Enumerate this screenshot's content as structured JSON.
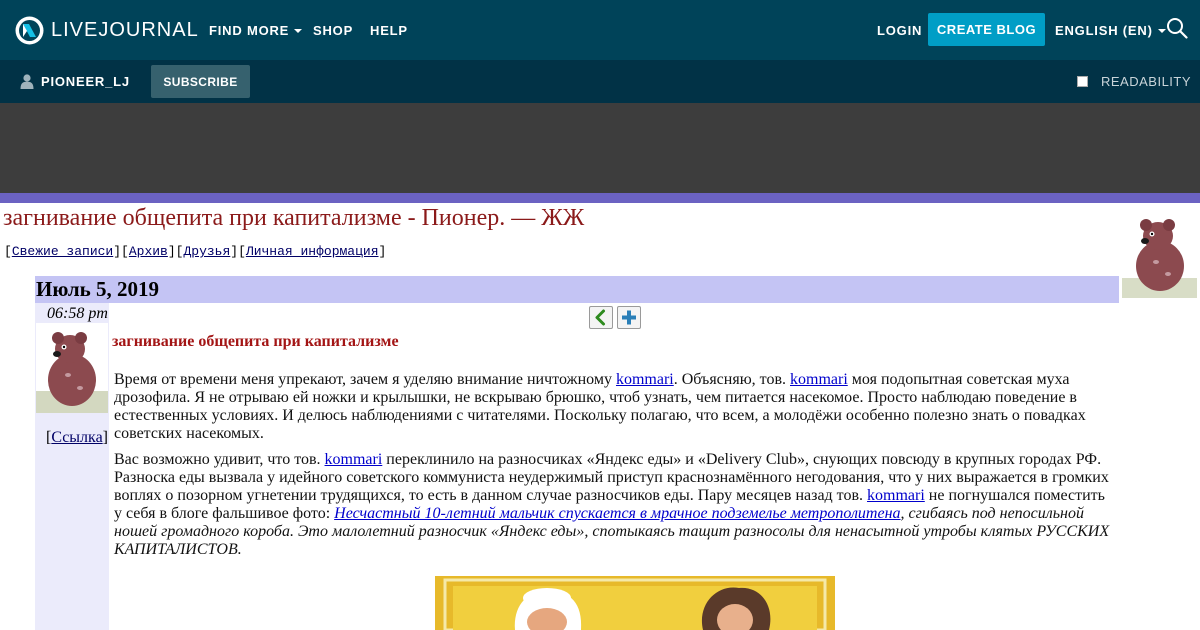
{
  "header": {
    "logo_text": "LIVEJOURNAL",
    "nav": {
      "find_more": "FIND MORE",
      "shop": "SHOP",
      "help": "HELP"
    },
    "login": "LOGIN",
    "create_blog": "CREATE BLOG",
    "language": "ENGLISH (EN)"
  },
  "subbar": {
    "username": "PIONEER_LJ",
    "subscribe": "SUBSCRIBE",
    "readability": "READABILITY"
  },
  "journal": {
    "page_title": "загнивание общепита при капитализме - Пионер. — ЖЖ",
    "nav_links": [
      "Свежие записи",
      "Архив",
      "Друзья",
      "Личная информация"
    ],
    "date": "Июль 5, 2019",
    "time": "06:58 pm",
    "link_label": "Ссылка"
  },
  "post": {
    "subject": "загнивание общепита при капитализме",
    "p1": {
      "t1": "Время от времени меня упрекают, зачем я уделяю внимание ничтожному ",
      "l1": "kommari",
      "t2": ". Объясняю, тов. ",
      "l2": "kommari",
      "t3": " моя подопытная советская муха дрозофила. Я не отрываю ей ножки и крылышки, не вскрываю брюшко, чтоб узнать, чем питается насекомое. Просто наблюдаю поведение в естественных условиях. И делюсь наблюдениями с читателями. Поскольку полагаю, что всем, а молодёжи особенно полезно знать о повадках советских насекомых."
    },
    "p2": {
      "t1": "Вас возможно удивит, что тов. ",
      "l1": "kommari",
      "t2": " переклинило на разносчиках «Яндекс еды» и «Delivery Club», снующих повсюду в крупных городах РФ. Разноска еды вызвала у идейного советского коммуниста неудержимый приступ краснознамённого негодования, что у них выражается в громких воплях о позорном угнетении трудящихся, то есть в данном случае разносчиков еды. Пару месяцев назад тов. ",
      "l2": "kommari",
      "t3": " не погнушался поместить у себя в блоге фальшивое фото: ",
      "l3": "Несчастный 10-летний мальчик спускается в мрачное подземелье метрополитена",
      "t4": ", сгибаясь под непосильной ношей громадного короба. Это малолетний разносчик «Яндекс еды», спотыкаясь тащит разносолы для ненасытной утробы клятых РУССКИХ КАПИТАЛИСТОВ."
    }
  },
  "colors": {
    "topbar": "#004359",
    "subbar": "#013246",
    "accent": "#009ec6",
    "stripe": "#6b62c2",
    "date_bar": "#c4c4f4",
    "title": "#8b1a1a"
  }
}
